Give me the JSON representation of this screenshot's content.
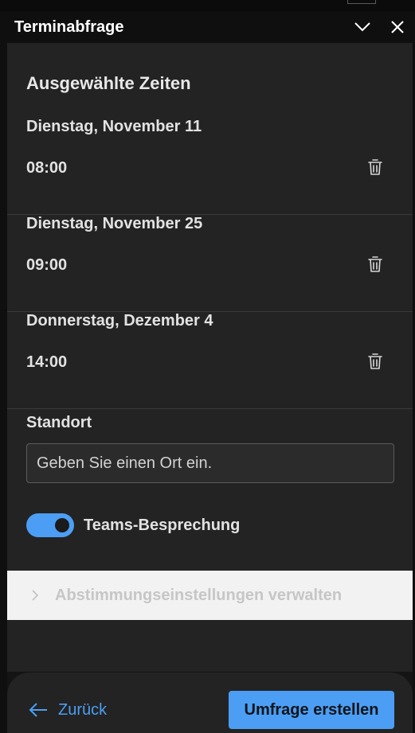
{
  "window": {
    "title": "Terminabfrage",
    "collapse_icon": "chevron-down-icon",
    "close_icon": "close-icon"
  },
  "selected_times": {
    "heading": "Ausgewählte Zeiten",
    "slots": [
      {
        "date": "Dienstag, November 11",
        "time": "08:00"
      },
      {
        "date": "Dienstag, November 25",
        "time": "09:00"
      },
      {
        "date": "Donnerstag, Dezember 4",
        "time": "14:00"
      }
    ],
    "delete_icon": "trash-icon"
  },
  "location": {
    "label": "Standort",
    "placeholder": "Geben Sie einen Ort ein.",
    "value": ""
  },
  "teams_meeting": {
    "label": "Teams-Besprechung",
    "enabled": true
  },
  "poll_settings": {
    "label": "Abstimmungseinstellungen verwalten",
    "icon": "chevron-right-icon"
  },
  "footer": {
    "back_label": "Zurück",
    "back_icon": "arrow-left-icon",
    "create_label": "Umfrage erstellen"
  },
  "colors": {
    "accent": "#4c9ef4",
    "panel": "#232323",
    "titlebar": "#0f0f0f"
  }
}
